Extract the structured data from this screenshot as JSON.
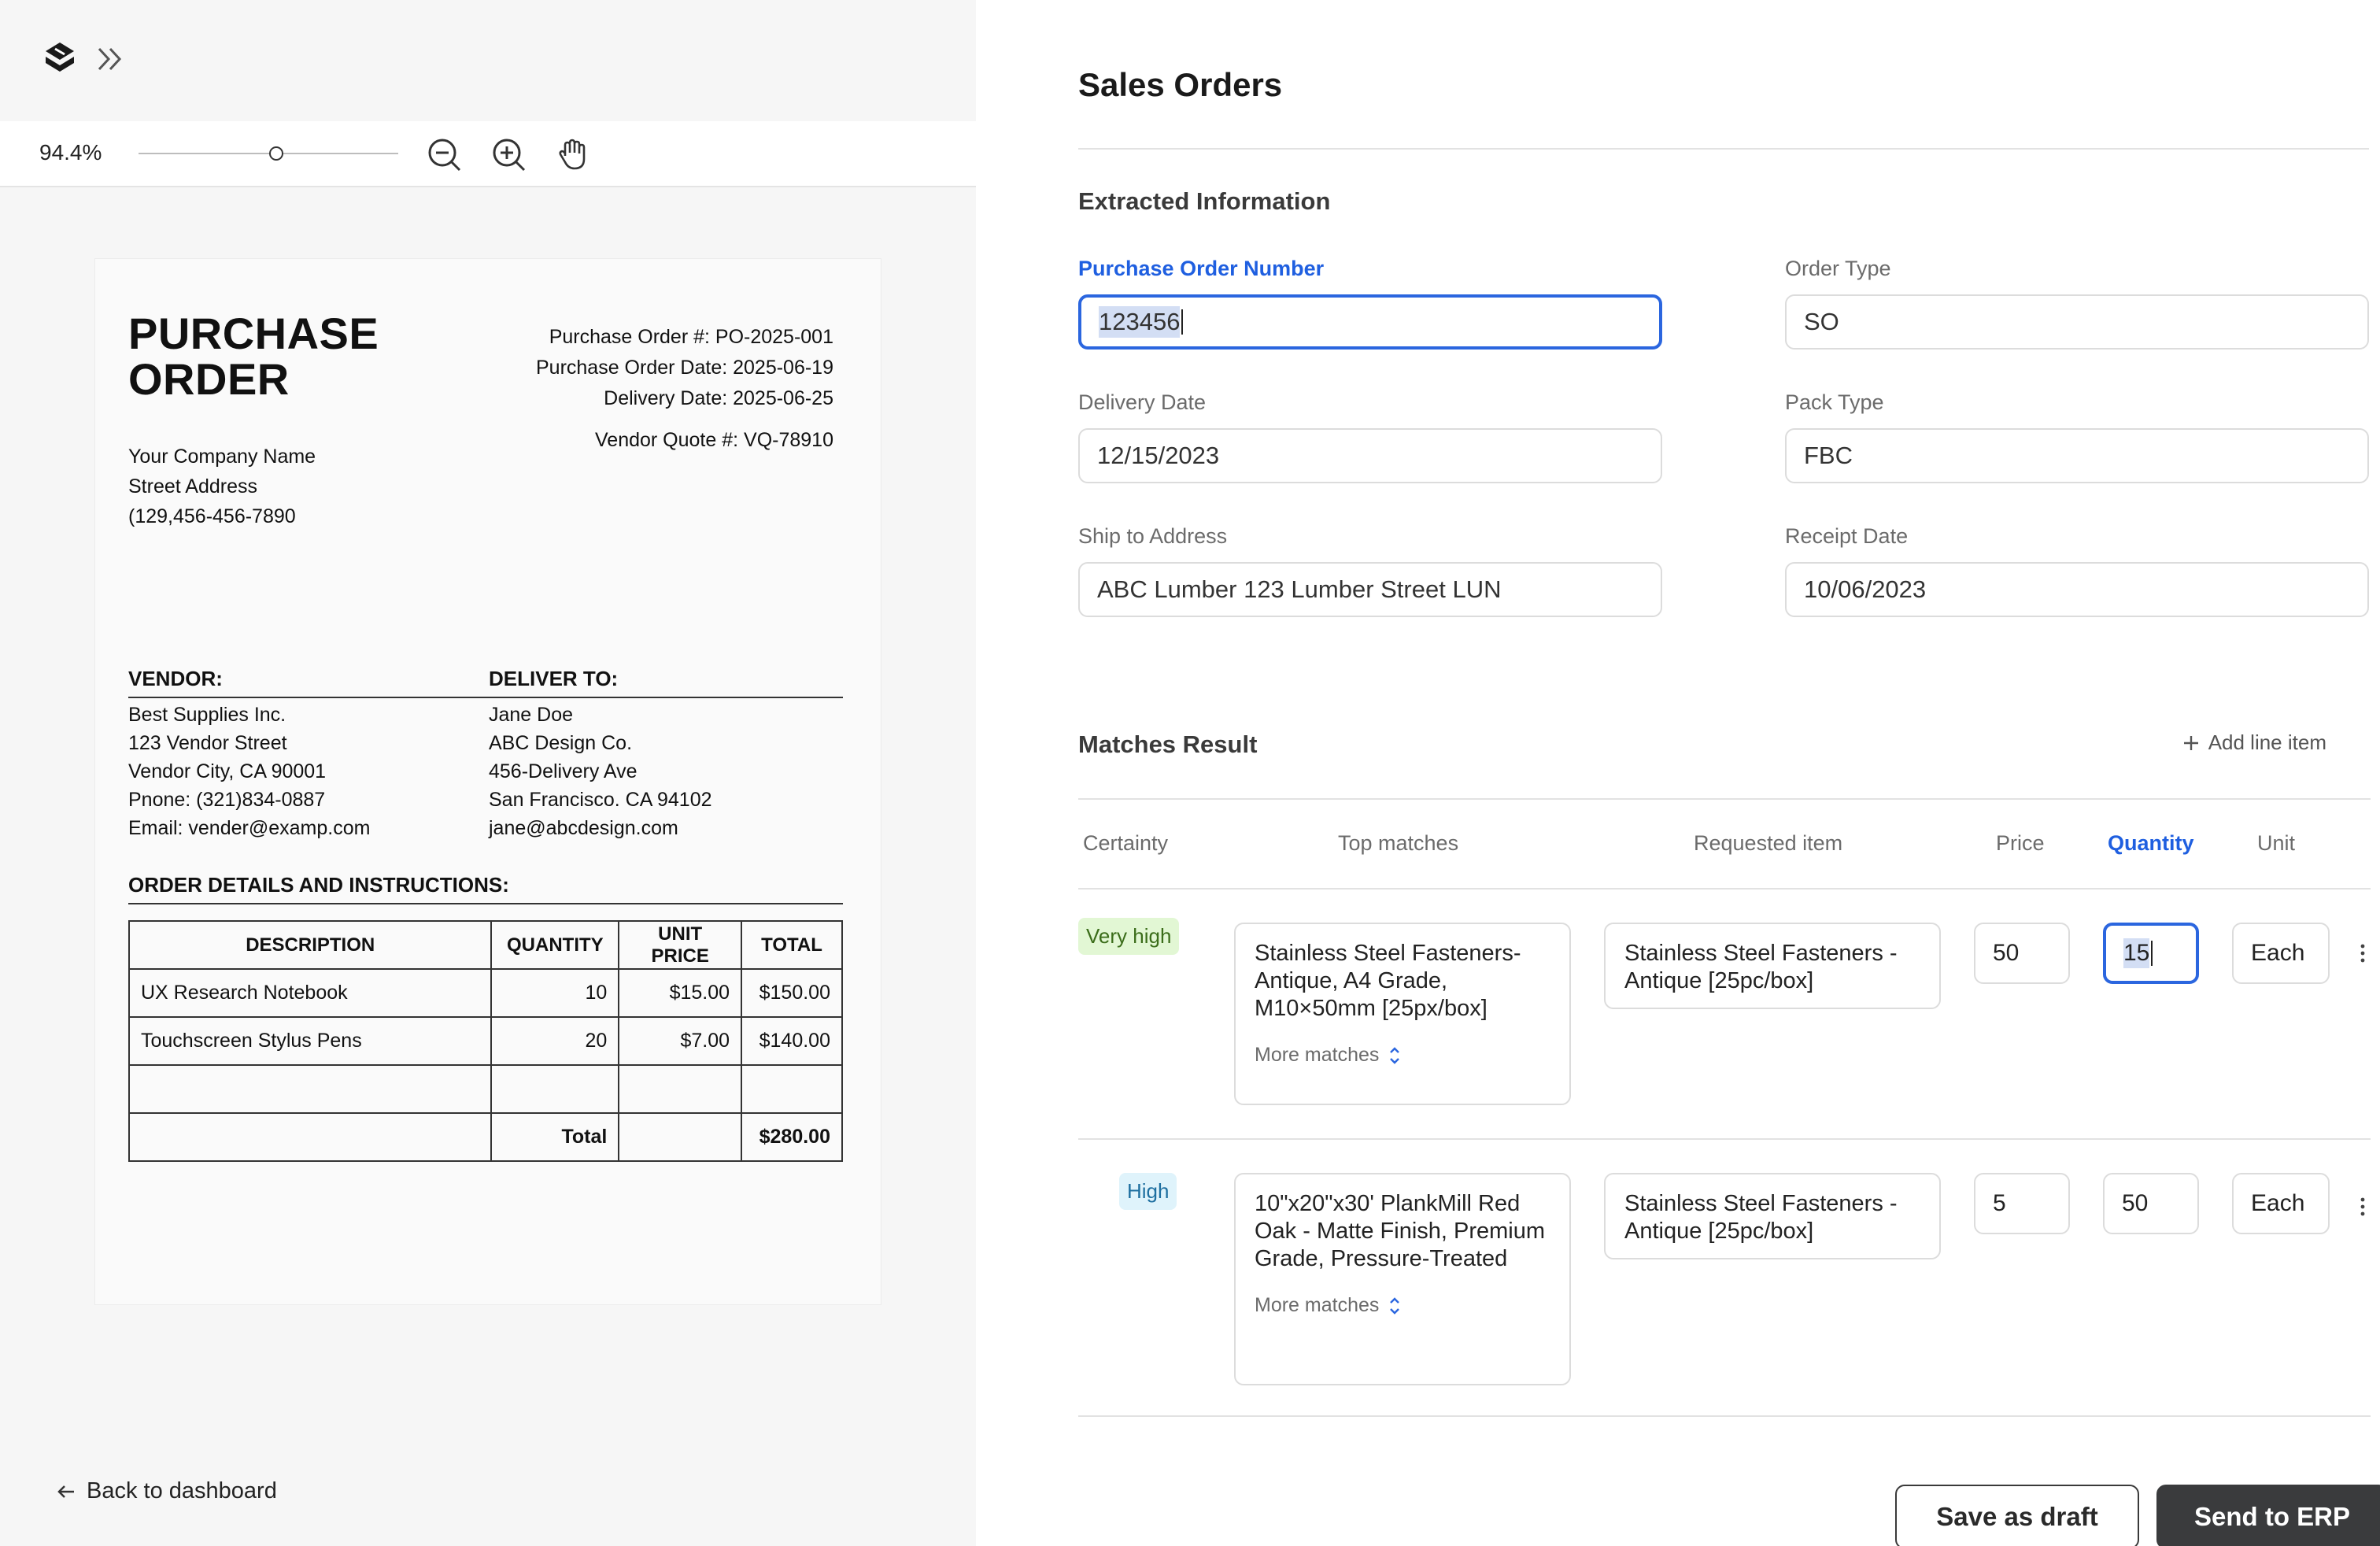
{
  "viewer": {
    "zoom": "94.4%",
    "zoom_slider_fraction": 0.53,
    "icons": [
      "logo-icon",
      "expand-icon",
      "zoom-out-icon",
      "zoom-in-icon",
      "hand-pan-icon"
    ],
    "back_label": "Back to dashboard"
  },
  "document": {
    "title_line1": "PURCHASE",
    "title_line2": "ORDER",
    "meta": {
      "po_number": "Purchase Order #: PO-2025-001",
      "po_date": "Purchase Order Date: 2025-06-19",
      "delivery_date": "Delivery Date: 2025-06-25",
      "vendor_quote": "Vendor Quote #: VQ-78910"
    },
    "company": {
      "name": "Your Company Name",
      "street": "Street Address",
      "phone": "(129,456-456-7890"
    },
    "vendor": {
      "heading": "VENDOR:",
      "lines": [
        "Best Supplies Inc.",
        "123 Vendor Street",
        "Vendor City, CA 90001",
        "Pnone: (321)834-0887",
        "Email: vender@examp.com"
      ]
    },
    "deliver_to": {
      "heading": "DELIVER TO:",
      "lines": [
        "Jane Doe",
        "ABC Design Co.",
        "456-Delivery Ave",
        "San Francisco. CA 94102",
        "jane@abcdesign.com"
      ]
    },
    "order_heading": "ORDER DETAILS AND INSTRUCTIONS:",
    "table": {
      "headers": [
        "DESCRIPTION",
        "QUANTITY",
        "UNIT PRICE",
        "TOTAL"
      ],
      "rows": [
        [
          "UX Research Notebook",
          "10",
          "$15.00",
          "$150.00"
        ],
        [
          "Touchscreen Stylus Pens",
          "20",
          "$7.00",
          "$140.00"
        ]
      ],
      "total_label": "Total",
      "total_value": "$280.00"
    }
  },
  "sales": {
    "title": "Sales Orders",
    "extracted_title": "Extracted Information",
    "fields": {
      "po_number": {
        "label": "Purchase Order Number",
        "value": "123456"
      },
      "order_type": {
        "label": "Order Type",
        "value": "SO"
      },
      "delivery_date": {
        "label": "Delivery Date",
        "value": "12/15/2023"
      },
      "pack_type": {
        "label": "Pack Type",
        "value": "FBC"
      },
      "ship_to": {
        "label": "Ship to Address",
        "value": "ABC Lumber 123 Lumber Street LUN"
      },
      "receipt_date": {
        "label": "Receipt Date",
        "value": "10/06/2023"
      }
    },
    "matches_title": "Matches Result",
    "add_line_label": "Add line item",
    "columns": {
      "certainty": "Certainty",
      "top_matches": "Top matches",
      "requested": "Requested item",
      "price": "Price",
      "quantity": "Quantity",
      "unit": "Unit"
    },
    "rows": [
      {
        "certainty": "Very high",
        "top_match": "Stainless Steel Fasteners-Antique, A4 Grade, M10×50mm [25px/box]",
        "more_matches": "More matches",
        "requested": "Stainless Steel Fasteners - Antique [25pc/box]",
        "price": "50",
        "quantity": "15",
        "unit": "Each"
      },
      {
        "certainty": "High",
        "top_match": "10\"x20\"x30' PlankMill Red Oak - Matte Finish, Premium Grade, Pressure-Treated",
        "more_matches": "More matches",
        "requested": "Stainless Steel Fasteners - Antique [25pc/box]",
        "price": "5",
        "quantity": "50",
        "unit": "Each"
      }
    ],
    "save_draft_label": "Save as draft",
    "send_erp_label": "Send to ERP"
  }
}
